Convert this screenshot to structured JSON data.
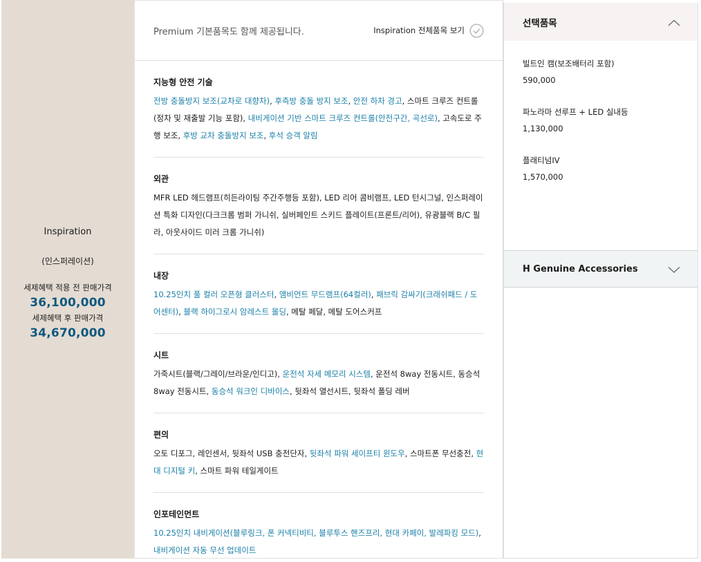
{
  "trim": {
    "name": "Inspiration",
    "name_kor": "(인스퍼레이션)",
    "price_before_label": "세제혜택 적용 전 판매가격",
    "price_before": "36,100,000",
    "price_after_label": "세제혜택 후 판매가격",
    "price_after": "34,670,000"
  },
  "main": {
    "premium_note": "Premium 기본품목도 함께 제공됩니다.",
    "view_all_label": "Inspiration 전체품목 보기",
    "sections": [
      {
        "title": "지능형 안전 기술",
        "parts": [
          {
            "text": "전방 충돌방지 보조(교차로 대향차)",
            "hl": true
          },
          {
            "text": ", ",
            "hl": false
          },
          {
            "text": "후측방 충돌 방지 보조",
            "hl": true
          },
          {
            "text": ", ",
            "hl": false
          },
          {
            "text": "안전 하차 경고",
            "hl": true
          },
          {
            "text": ", 스마트 크루즈 컨트롤(정차 및 재출발 기능 포함), ",
            "hl": false
          },
          {
            "text": "내비게이션 기반 스마트 크루즈 컨트롤(안전구간, 곡선로)",
            "hl": true
          },
          {
            "text": ", 고속도로 주행 보조, ",
            "hl": false
          },
          {
            "text": "후방 교차 충돌방지 보조",
            "hl": true
          },
          {
            "text": ", ",
            "hl": false
          },
          {
            "text": "후석 승객 알림",
            "hl": true
          }
        ]
      },
      {
        "title": "외관",
        "parts": [
          {
            "text": "MFR LED 헤드램프(히든라이팅 주간주행등 포함), LED 리어 콤비램프, LED 턴시그널, 인스퍼레이션 특화 디자인(다크크롬 범퍼 가니쉬, 실버페인트 스키드 플레이트(프론트/리어), 유광블랙 B/C 필라, 아웃사이드 미러 크롬 가니쉬)",
            "hl": false
          }
        ]
      },
      {
        "title": "내장",
        "parts": [
          {
            "text": "10.25인치 풀 컬러 오픈형 클러스터",
            "hl": true
          },
          {
            "text": ", ",
            "hl": false
          },
          {
            "text": "앰비언트 무드램프(64컬러)",
            "hl": true
          },
          {
            "text": ", ",
            "hl": false
          },
          {
            "text": "패브릭 감싸기(크래쉬패드 / 도어센터)",
            "hl": true
          },
          {
            "text": ", ",
            "hl": false
          },
          {
            "text": "블랙 하이그로시 암레스트 몰딩",
            "hl": true
          },
          {
            "text": ", 메탈 페달, 메탈 도어스커프",
            "hl": false
          }
        ]
      },
      {
        "title": "시트",
        "parts": [
          {
            "text": "가죽시트(블랙/그레이/브라운/인디고), ",
            "hl": false
          },
          {
            "text": "운전석 자세 메모리 시스템",
            "hl": true
          },
          {
            "text": ", 운전석 8way 전동시트, 동승석 8way 전동시트, ",
            "hl": false
          },
          {
            "text": "동승석 워크인 디바이스",
            "hl": true
          },
          {
            "text": ", 뒷좌석 열선시트, 뒷좌석 폴딩 레버",
            "hl": false
          }
        ]
      },
      {
        "title": "편의",
        "parts": [
          {
            "text": "오토 디포그, 레인센서, 뒷좌석 USB 충전단자, ",
            "hl": false
          },
          {
            "text": "뒷좌석 파워 세이프티 윈도우",
            "hl": true
          },
          {
            "text": ", 스마트폰 무선충전, ",
            "hl": false
          },
          {
            "text": "현대 디지털 키",
            "hl": true
          },
          {
            "text": ", 스마트 파워 테일게이트",
            "hl": false
          }
        ]
      },
      {
        "title": "인포테인먼트",
        "parts": [
          {
            "text": "10.25인치 내비게이션(블루링크, 폰 커넥티비티, 블루투스 핸즈프리, 현대 카페이, 발레파킹 모드)",
            "hl": true
          },
          {
            "text": ", ",
            "hl": false
          },
          {
            "text": "내비게이션 자동 무선 업데이트",
            "hl": true
          }
        ]
      }
    ]
  },
  "selected": {
    "title": "선택품목",
    "items": [
      {
        "name": "빌트인 캠(보조배터리 포함)",
        "price": "590,000"
      },
      {
        "name": "파노라마 선루프 + LED 실내등",
        "price": "1,130,000"
      },
      {
        "name": "플래티넘IV",
        "price": "1,570,000"
      }
    ]
  },
  "accessories": {
    "title": "H Genuine Accessories"
  },
  "icons": {
    "view_all": "check-circle-icon",
    "selected_toggle": "chevron-up-icon",
    "accessories_toggle": "chevron-down-icon"
  },
  "colors": {
    "price_blue": "#11597f",
    "link_blue": "#1a7fa8",
    "beige": "#e4dcd3"
  }
}
